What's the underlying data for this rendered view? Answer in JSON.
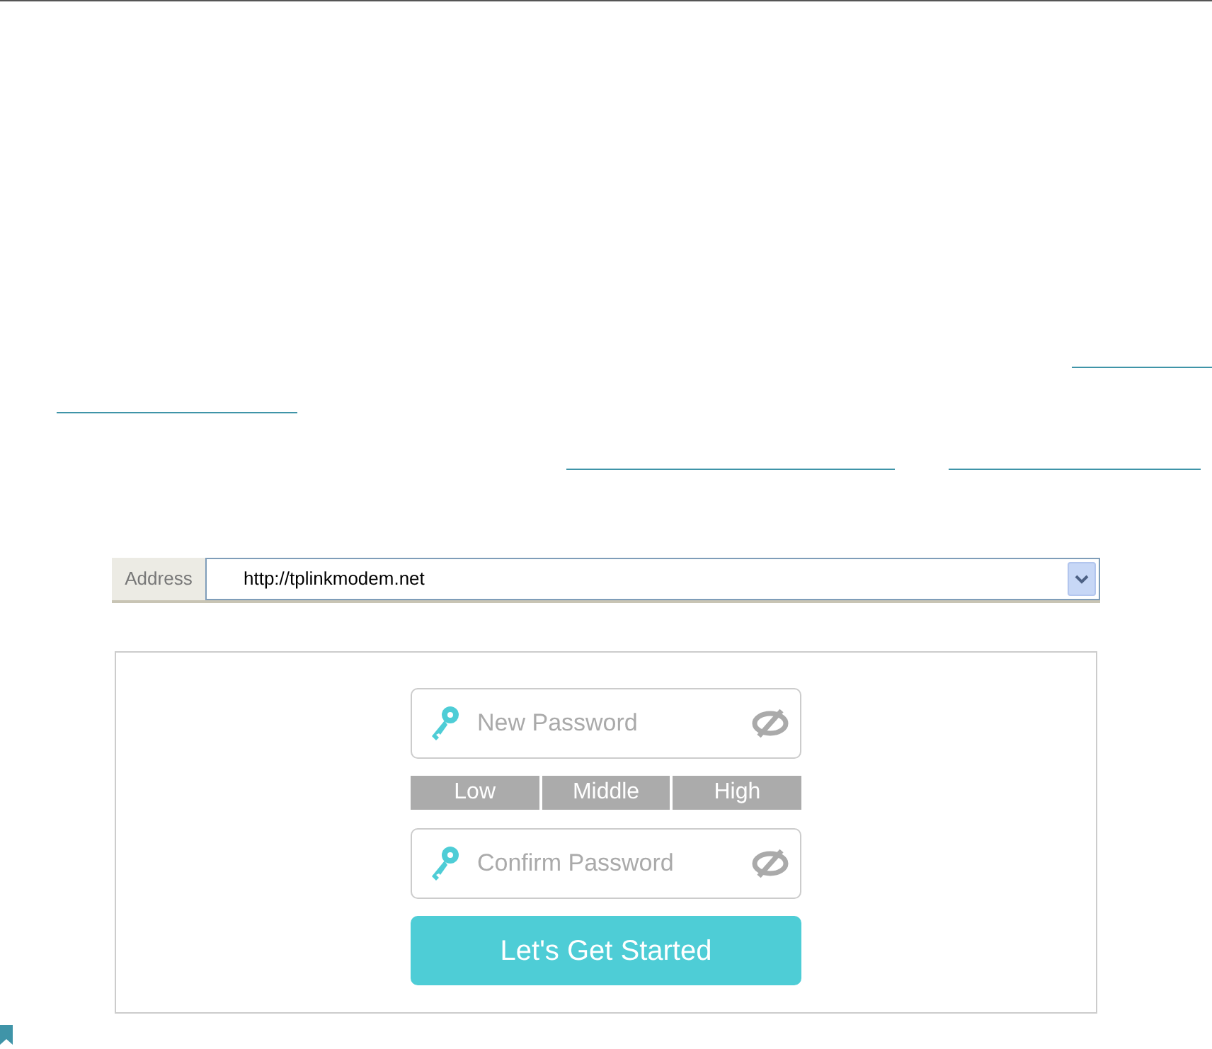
{
  "address_bar": {
    "label": "Address",
    "url": "http://tplinkmodem.net"
  },
  "password_form": {
    "fields": [
      {
        "placeholder": "New Password"
      },
      {
        "placeholder": "Confirm Password"
      }
    ],
    "strength": [
      {
        "label": "Low",
        "active": false
      },
      {
        "label": "Middle",
        "active": false
      },
      {
        "label": "High",
        "active": false
      }
    ],
    "button": "Let's Get Started"
  }
}
